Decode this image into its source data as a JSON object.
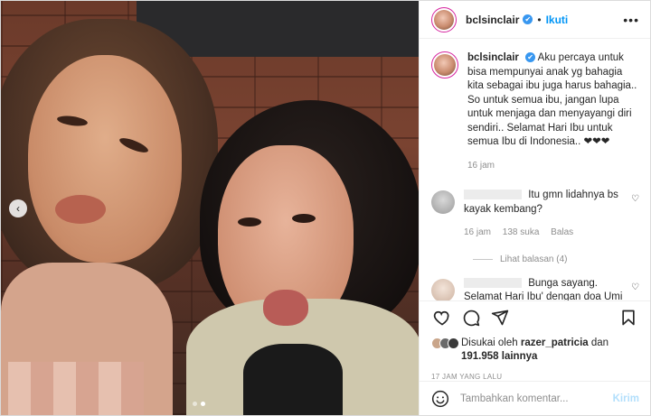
{
  "post": {
    "username": "bclsinclair",
    "separator": "•",
    "follow_label": "Ikuti",
    "more_label": "•••"
  },
  "caption": {
    "username": "bclsinclair",
    "text": "Aku percaya untuk bisa mempunyai anak yg bahagia kita sebagai ibu juga harus bahagia.. So untuk semua ibu, jangan lupa untuk menjaga dan menyayangi diri sendiri.. Selamat Hari Ibu untuk semua Ibu di Indonesia.. ❤❤❤",
    "time": "16 jam"
  },
  "comments": [
    {
      "text": "Itu gmn lidahnya bs kayak kembang?",
      "time": "16 jam",
      "likes": "138 suka",
      "reply": "Balas",
      "view_replies": "Lihat balasan (4)"
    },
    {
      "text": "Bunga sayang. Selamat Hari Ibu' dengan doa Umi semoga Bunga sentiasa dalam keadaan"
    }
  ],
  "likes": {
    "prefix": "Disukai oleh",
    "user": "razer_patricia",
    "connector": "dan",
    "count": "191.958 lainnya"
  },
  "timestamp": "17 JAM YANG LALU",
  "add_comment": {
    "placeholder": "Tambahkan komentar...",
    "post_label": "Kirim"
  },
  "icons": {
    "verified": "✔",
    "heart": "♡",
    "prev": "‹"
  },
  "colors": {
    "accent": "#0095f6",
    "verified": "#3897f0",
    "muted": "#8e8e8e",
    "post_disabled": "#b2dffc"
  }
}
